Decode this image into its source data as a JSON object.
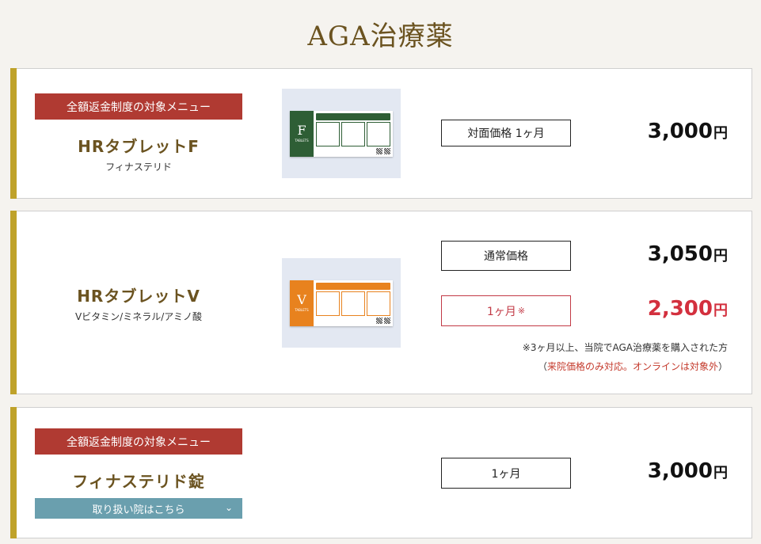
{
  "page": {
    "title": "AGA治療薬"
  },
  "products": [
    {
      "badge": "全額返金制度の対象メニュー",
      "name": "HRタブレットF",
      "sub": "フィナステリド",
      "box_letter": "F",
      "box_caption": "TABLETS",
      "box_color": "#2e5e35",
      "prices": [
        {
          "label": "対面価格 1ヶ月",
          "value": "3,000",
          "unit": "円"
        }
      ]
    },
    {
      "name": "HRタブレットV",
      "sub": "Vビタミン/ミネラル/アミノ酸",
      "box_letter": "V",
      "box_caption": "TABLETS",
      "box_color": "#e8821e",
      "prices": [
        {
          "label": "通常価格",
          "value": "3,050",
          "unit": "円"
        },
        {
          "label": "1ヶ月",
          "mark": "※",
          "value": "2,300",
          "unit": "円"
        }
      ],
      "note1": "※3ヶ月以上、当院でAGA治療薬を購入された方",
      "note2_open": "（",
      "note2_red": "来院価格のみ対応。オンラインは対象外",
      "note2_close": "）"
    },
    {
      "badge": "全額返金制度の対象メニュー",
      "name": "フィナステリド錠",
      "clinic_button": "取り扱い院はこちら",
      "prices": [
        {
          "label": "1ヶ月",
          "value": "3,000",
          "unit": "円"
        }
      ]
    }
  ],
  "colors": {
    "accent_gold": "#bfa22a",
    "badge_red": "#b03a32",
    "title_brown": "#6b5320",
    "discount_red": "#d3303e",
    "button_teal": "#6a9fae"
  }
}
